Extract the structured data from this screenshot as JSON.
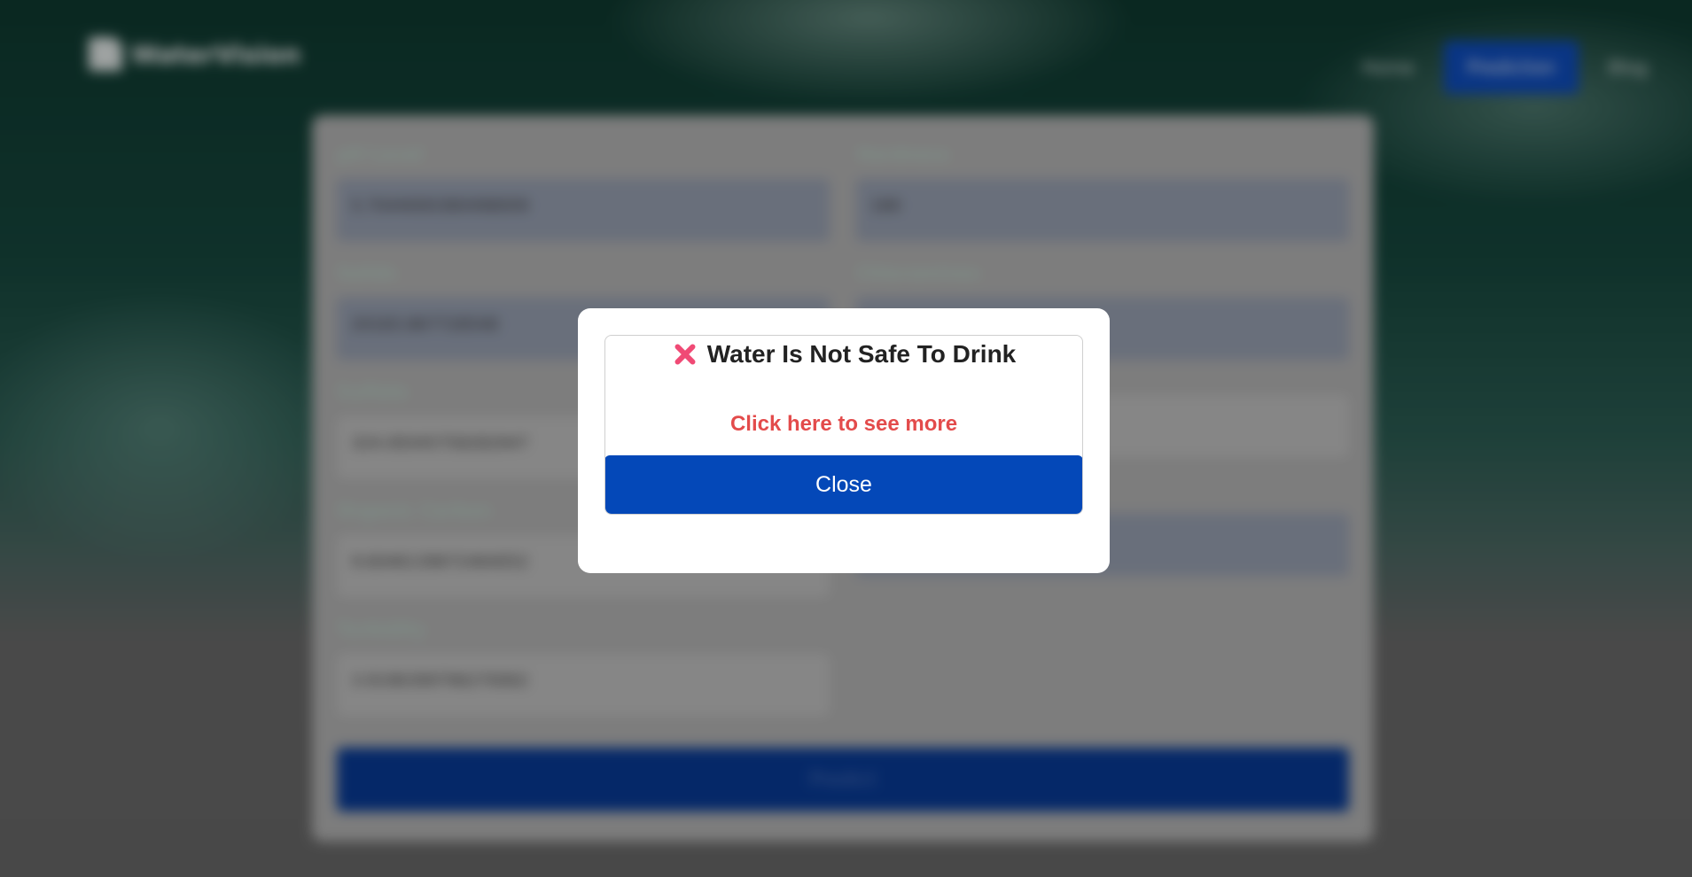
{
  "background": {
    "brand": "WaterVision",
    "nav": [
      "Home",
      "Prediction",
      "Blog"
    ],
    "fields": [
      {
        "label": "pH Level",
        "value": "5.7044000380498009",
        "light": false
      },
      {
        "label": "Hardness",
        "value": "180",
        "light": false
      },
      {
        "label": "Solids",
        "value": "20183.867728548",
        "light": false
      },
      {
        "label": "Chloramines",
        "value": "",
        "light": false
      },
      {
        "label": "Sulfate",
        "value": "324.09345758282947",
        "light": true
      },
      {
        "label": "",
        "value": "",
        "light": true
      },
      {
        "label": "Organic Carbon",
        "value": "9.6046139672464052",
        "light": true
      },
      {
        "label": "",
        "value": "62",
        "light": false
      },
      {
        "label": "Turbidity",
        "value": "3.9196399796270062",
        "light": true
      }
    ],
    "predict_label": "Predict"
  },
  "modal": {
    "icon": "close-x-icon",
    "title": "Water Is Not Safe To Drink",
    "link": "Click here to see more",
    "close_label": "Close"
  },
  "colors": {
    "danger": "#e34b4b",
    "icon_pink": "#f04a75",
    "primary": "#0448b8"
  }
}
